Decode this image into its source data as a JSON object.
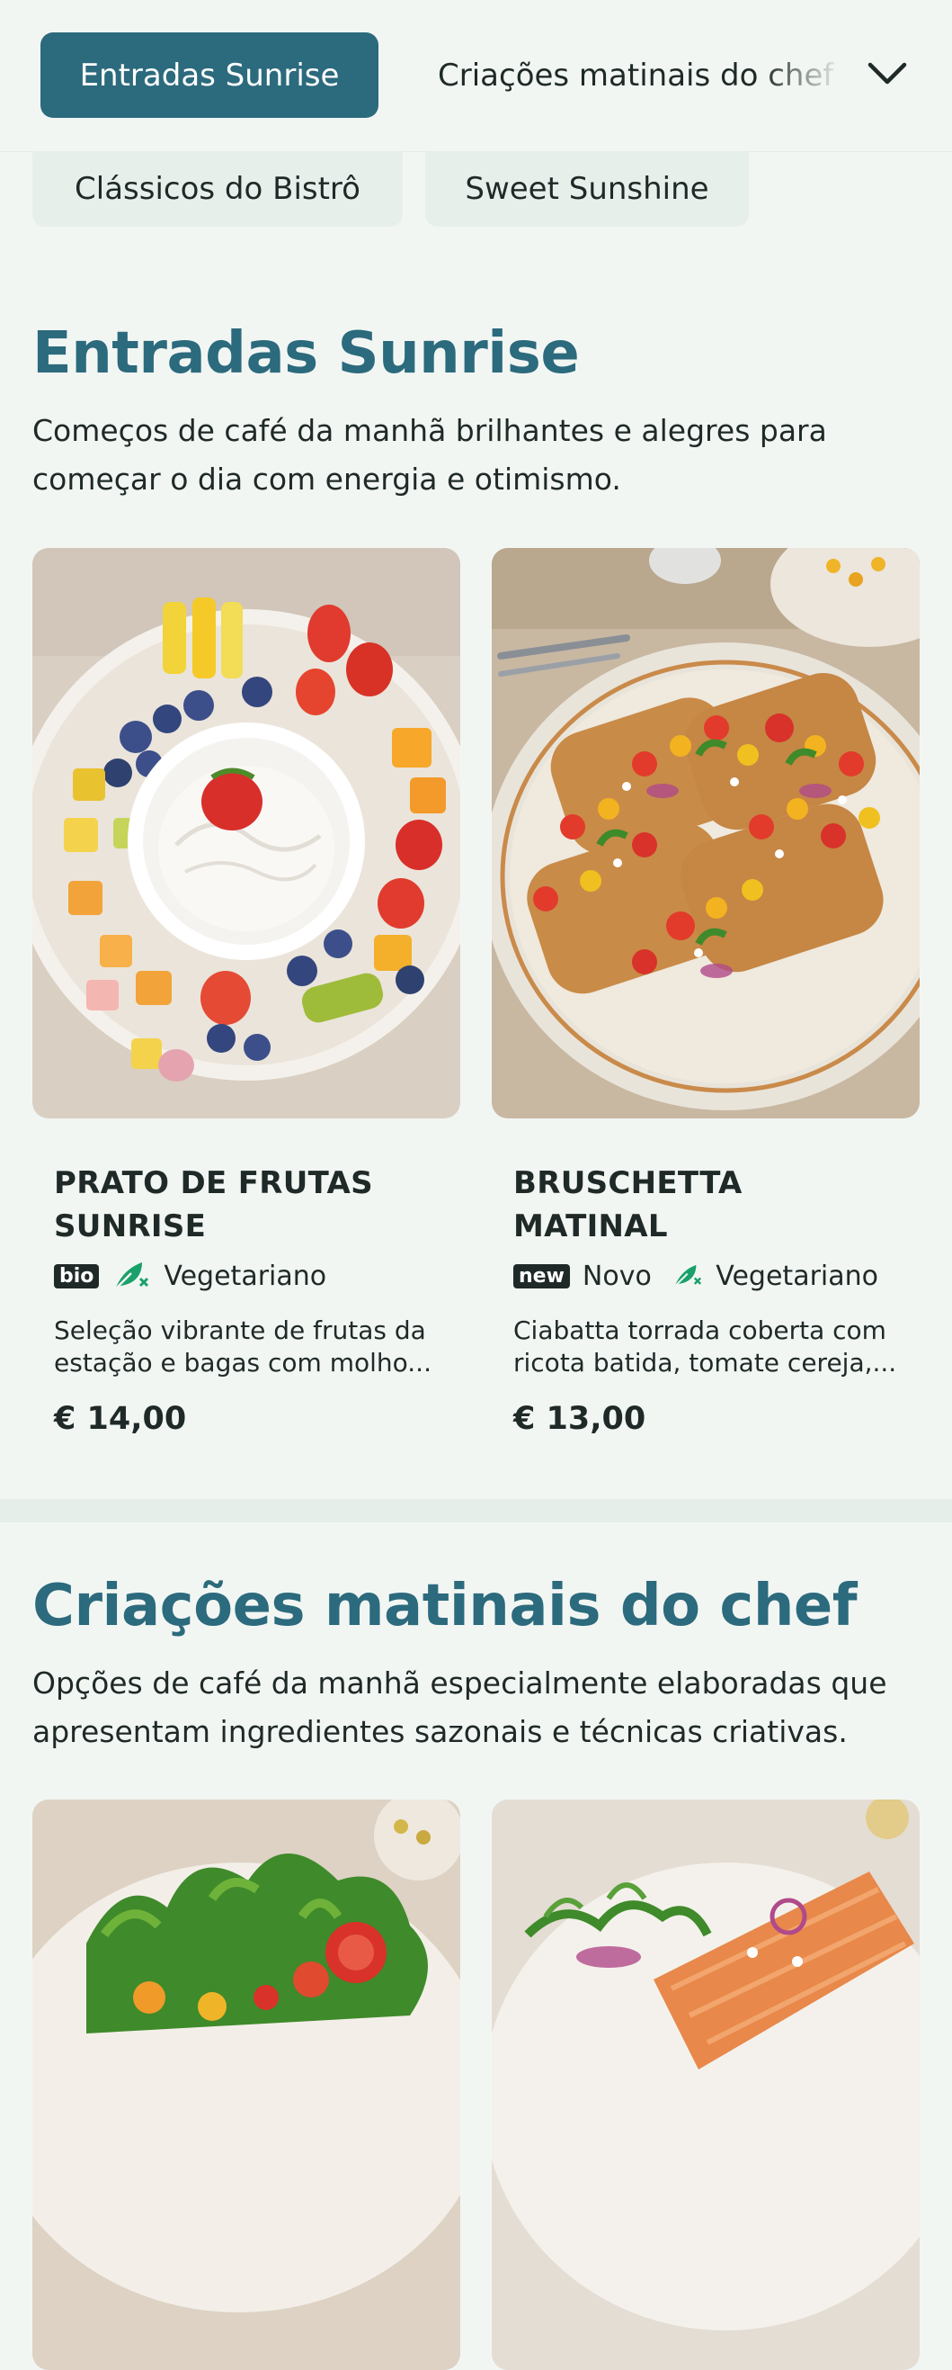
{
  "nav": {
    "active_tab": "Entradas Sunrise",
    "inline_tab": "Criações matinais do chef",
    "chips": [
      "Clássicos do Bistrô",
      "Sweet Sunshine"
    ]
  },
  "sections": [
    {
      "title": "Entradas Sunrise",
      "description": "Começos de café da manhã brilhantes e alegres para começar o dia com energia e otimismo.",
      "items": [
        {
          "name": "PRATO DE FRUTAS SUNRISE",
          "badge": "bio",
          "tags": [
            "Vegetariano"
          ],
          "description": "Seleção vibrante de frutas da estação e bagas com molho...",
          "price": "€ 14,00"
        },
        {
          "name": "BRUSCHETTA MATINAL",
          "badge": "new",
          "badge_label": "Novo",
          "tags": [
            "Vegetariano"
          ],
          "description": "Ciabatta torrada coberta com ricota batida, tomate cereja,...",
          "price": "€ 13,00"
        }
      ]
    },
    {
      "title": "Criações matinais do chef",
      "description": "Opções de café da manhã especialmente elaboradas que apresentam ingredientes sazonais e técnicas criativas."
    }
  ],
  "icons": {
    "chevron": "chevron-down-icon",
    "vegetarian": "leaf-icon"
  },
  "colors": {
    "accent": "#2c6a7d",
    "background": "#f2f6f3",
    "vegetarian_icon": "#1aa06a"
  }
}
